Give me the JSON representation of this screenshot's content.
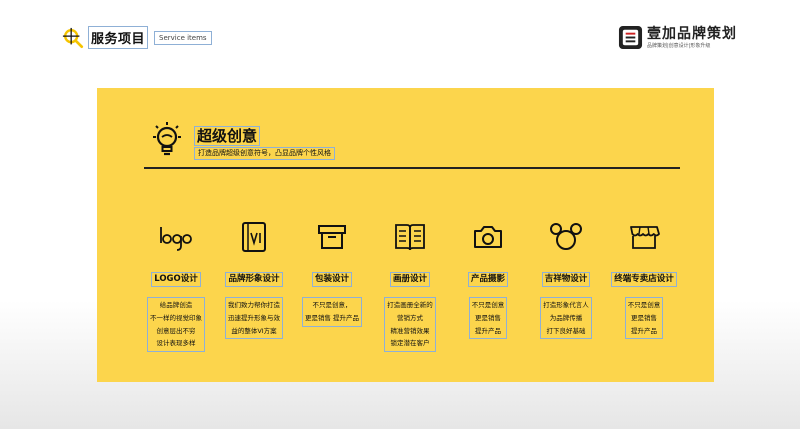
{
  "header": {
    "title": "服务项目",
    "subtitle": "Service items"
  },
  "brand": {
    "name": "壹加品牌策划",
    "tagline": "品牌策划|创意设计|形象升级"
  },
  "panel": {
    "title": "超级创意",
    "subtitle": "打造品牌超级创意符号，凸显品牌个性风格",
    "items": [
      {
        "title": "LOGO设计",
        "lines": [
          "给品牌创造",
          "不一样的视觉印象",
          "创意层出不穷",
          "设计表现多样"
        ]
      },
      {
        "title": "品牌形象设计",
        "lines": [
          "我们致力帮你打造",
          "迅速提升形象与效",
          "益的整体VI方案"
        ]
      },
      {
        "title": "包装设计",
        "lines": [
          "不只是创意，",
          "更是销售 提升产品"
        ]
      },
      {
        "title": "画册设计",
        "lines": [
          "打造画册全新的",
          "营销方式",
          "精准营销效果",
          "锁定潜在客户"
        ]
      },
      {
        "title": "产品摄影",
        "lines": [
          "不只是创意",
          "更是销售",
          "提升产品"
        ]
      },
      {
        "title": "吉祥物设计",
        "lines": [
          "打造形象代言人",
          "为品牌传播",
          "打下良好基础"
        ]
      },
      {
        "title": "终端专卖店设计",
        "lines": [
          "不只是创意",
          "更是销售",
          "提升产品"
        ]
      }
    ]
  },
  "colors": {
    "panel": "#fcd54c",
    "magnifier": "#f5c400",
    "ink": "#111111"
  },
  "icons": [
    "magnifier-icon",
    "brand-logo-icon",
    "lightbulb-icon",
    "logo-word-icon",
    "vi-card-icon",
    "box-icon",
    "book-icon",
    "camera-icon",
    "mouse-ears-icon",
    "storefront-icon"
  ]
}
